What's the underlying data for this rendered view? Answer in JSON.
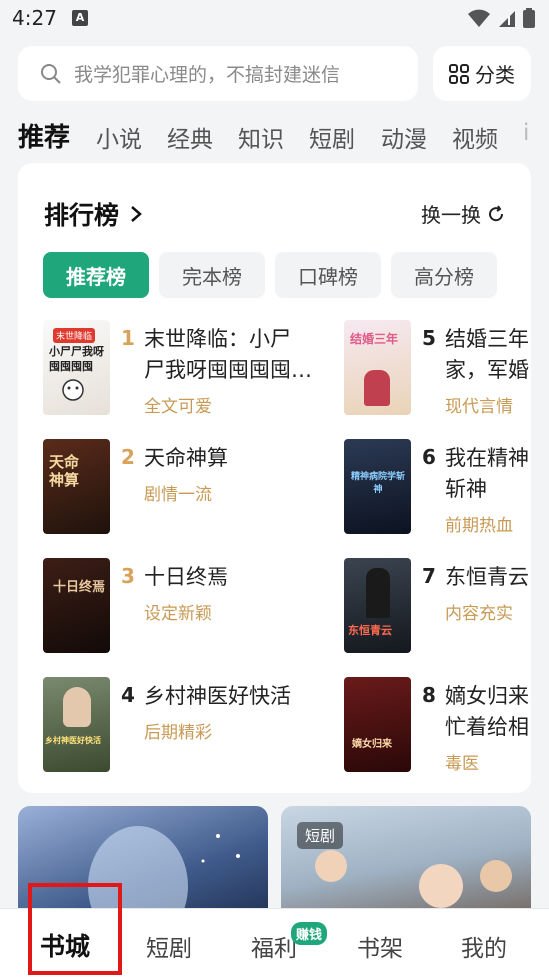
{
  "status_bar": {
    "time": "4:27",
    "notification_glyph": "A"
  },
  "search": {
    "placeholder": "我学犯罪心理的，不搞封建迷信"
  },
  "category_button": {
    "label": "分类"
  },
  "tabs": [
    "推荐",
    "小说",
    "经典",
    "知识",
    "短剧",
    "动漫",
    "视频",
    "i"
  ],
  "ranking": {
    "title": "排行榜",
    "refresh_label": "换一换",
    "chips": [
      "推荐榜",
      "完本榜",
      "口碑榜",
      "高分榜"
    ],
    "books": [
      {
        "rank": "1",
        "title_line1": "末世降临：小尸",
        "title_line2": "尸我呀囤囤囤囤…",
        "tag": "全文可爱",
        "cover_text": "末世降临"
      },
      {
        "rank": "2",
        "title_line1": "天命神算",
        "title_line2": "",
        "tag": "剧情一流",
        "cover_text": "天命神算"
      },
      {
        "rank": "3",
        "title_line1": "十日终焉",
        "title_line2": "",
        "tag": "设定新颖",
        "cover_text": "十日终焉"
      },
      {
        "rank": "4",
        "title_line1": "乡村神医好快活",
        "title_line2": "",
        "tag": "后期精彩",
        "cover_text": "乡村神医好快活"
      },
      {
        "rank": "5",
        "title_line1": "结婚三年",
        "title_line2": "家，军婚",
        "tag": "现代言情",
        "cover_text": "结婚三年"
      },
      {
        "rank": "6",
        "title_line1": "我在精神",
        "title_line2": "斩神",
        "tag": "前期热血",
        "cover_text": "精神病院学斩神"
      },
      {
        "rank": "7",
        "title_line1": "东恒青云",
        "title_line2": "",
        "tag": "内容充实",
        "cover_text": "东恒青云"
      },
      {
        "rank": "8",
        "title_line1": "嫡女归来",
        "title_line2": "忙着给相",
        "tag": "毒医",
        "cover_text": "嫡女归来"
      }
    ]
  },
  "banners": [
    {
      "badge": ""
    },
    {
      "badge": "短剧"
    }
  ],
  "bottom_nav": {
    "items": [
      "书城",
      "短剧",
      "福利",
      "书架",
      "我的"
    ],
    "earn_badge": "赚钱"
  },
  "colors": {
    "accent": "#1fa67a",
    "tag": "#c89a55",
    "rank_gold": "#d9a25b",
    "highlight": "#e01818"
  }
}
